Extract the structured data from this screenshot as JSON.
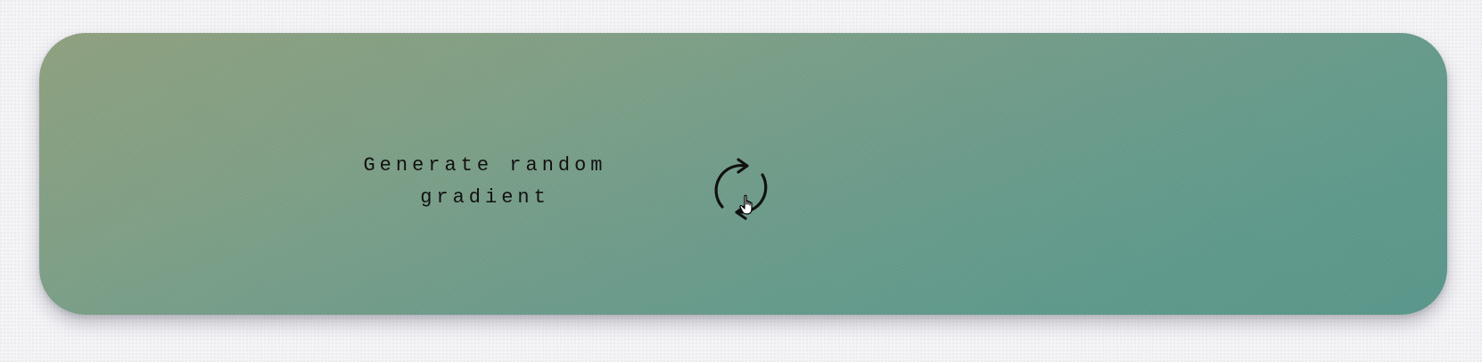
{
  "main": {
    "label_line1": "Generate random",
    "label_line2": "gradient"
  },
  "refresh_button": {
    "icon": "refresh-icon",
    "aria_label": "Generate random gradient"
  },
  "colors": {
    "gradient_start": "#8fa17f",
    "gradient_end": "#5a978b",
    "text": "#111111"
  }
}
